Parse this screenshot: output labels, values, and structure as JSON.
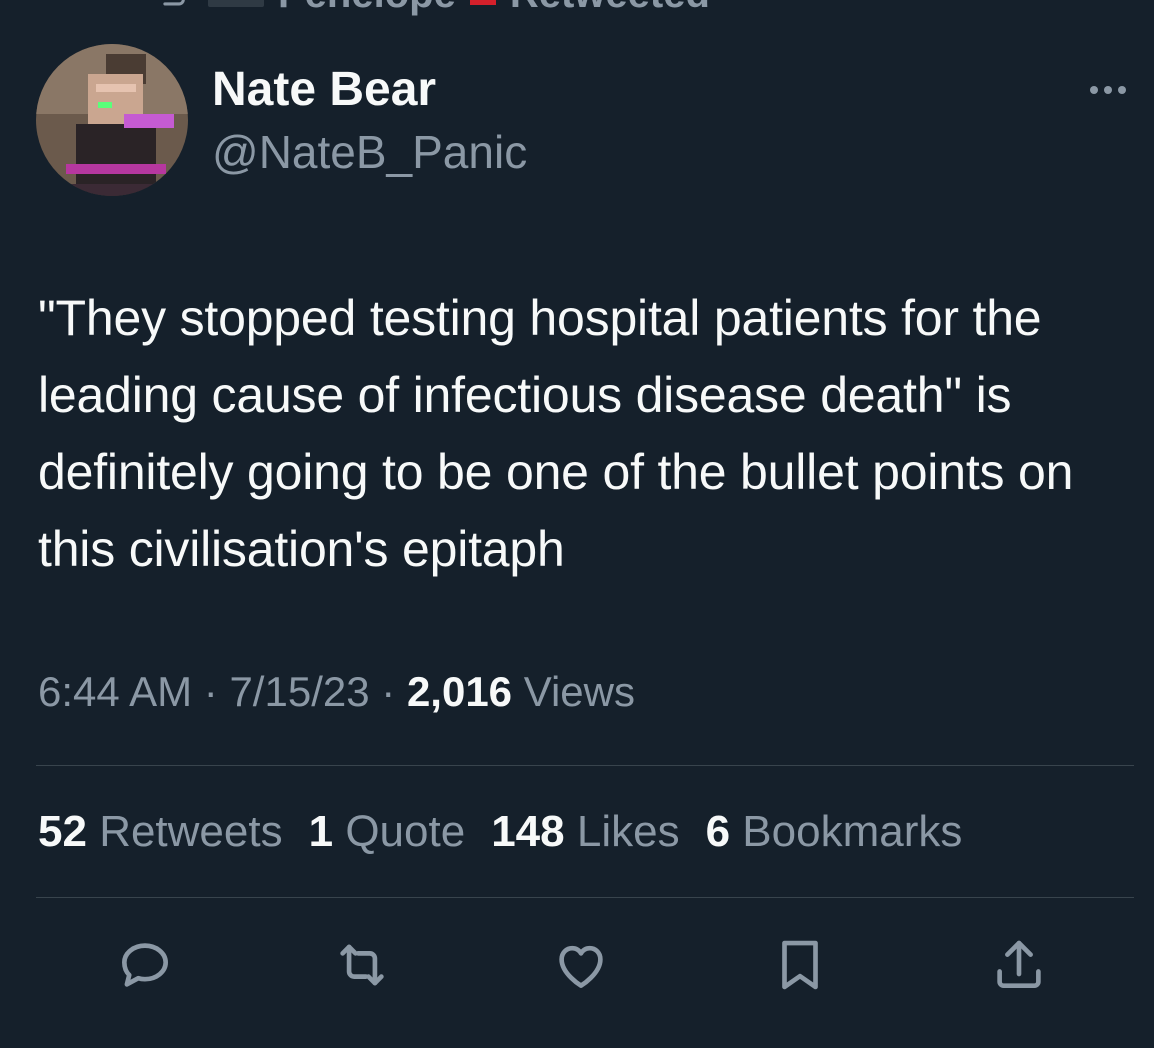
{
  "context": {
    "author": "Penelope",
    "action": "Retweeted"
  },
  "author": {
    "name": "Nate Bear",
    "handle": "@NateB_Panic"
  },
  "tweet": {
    "text": "\"They stopped testing hospital patients for the leading cause of infectious disease death\" is definitely going to be one of the bullet points on this civilisation's epitaph"
  },
  "meta": {
    "time": "6:44 AM",
    "separator": "·",
    "date": "7/15/23",
    "views_count": "2,016",
    "views_label": "Views"
  },
  "stats": {
    "retweets_count": "52",
    "retweets_label": "Retweets",
    "quotes_count": "1",
    "quotes_label": "Quote",
    "likes_count": "148",
    "likes_label": "Likes",
    "bookmarks_count": "6",
    "bookmarks_label": "Bookmarks"
  },
  "icons": {
    "more": "more-horizontal-icon",
    "reply": "reply-icon",
    "retweet": "retweet-icon",
    "like": "heart-icon",
    "bookmark": "bookmark-icon",
    "share": "share-icon"
  },
  "colors": {
    "background": "#15202b",
    "primary_text": "#f7f9f9",
    "secondary_text": "#8b98a5",
    "divider": "#38444d"
  }
}
